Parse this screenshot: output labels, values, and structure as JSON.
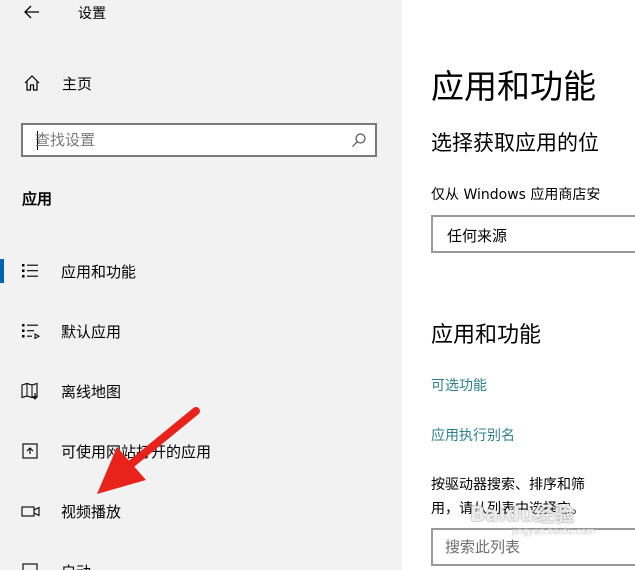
{
  "window": {
    "title": "设置"
  },
  "sidebar": {
    "home_label": "主页",
    "search": {
      "value": "",
      "placeholder": "查找设置"
    },
    "section_label": "应用",
    "items": [
      {
        "label": "应用和功能",
        "icon": "apps-features-icon",
        "selected": true
      },
      {
        "label": "默认应用",
        "icon": "default-apps-icon",
        "selected": false
      },
      {
        "label": "离线地图",
        "icon": "offline-maps-icon",
        "selected": false
      },
      {
        "label": "可使用网站打开的应用",
        "icon": "apps-for-websites-icon",
        "selected": false
      },
      {
        "label": "视频播放",
        "icon": "video-playback-icon",
        "selected": false
      },
      {
        "label": "启动",
        "icon": "startup-icon",
        "selected": false
      }
    ]
  },
  "main": {
    "page_title": "应用和功能",
    "install_source": {
      "heading": "选择获取应用的位",
      "description": "仅从 Windows 应用商店安",
      "selected_option": "任何来源"
    },
    "apps_section": {
      "heading": "应用和功能",
      "optional_features_link": "可选功能",
      "aliases_link": "应用执行别名",
      "description_line1": "按驱动器搜索、排序和筛",
      "description_line2": "用，请从列表中选择它。",
      "list_search": {
        "value": "",
        "placeholder": "搜索此列表"
      }
    }
  },
  "overlay": {
    "watermark": "Baidu经验",
    "watermark_sub": "jingyan.baidu.com"
  },
  "colors": {
    "sidebar_bg": "#f2f2f2",
    "accent": "#0063b1",
    "link": "#2e7f8c",
    "annotation_arrow": "#e8231b"
  }
}
